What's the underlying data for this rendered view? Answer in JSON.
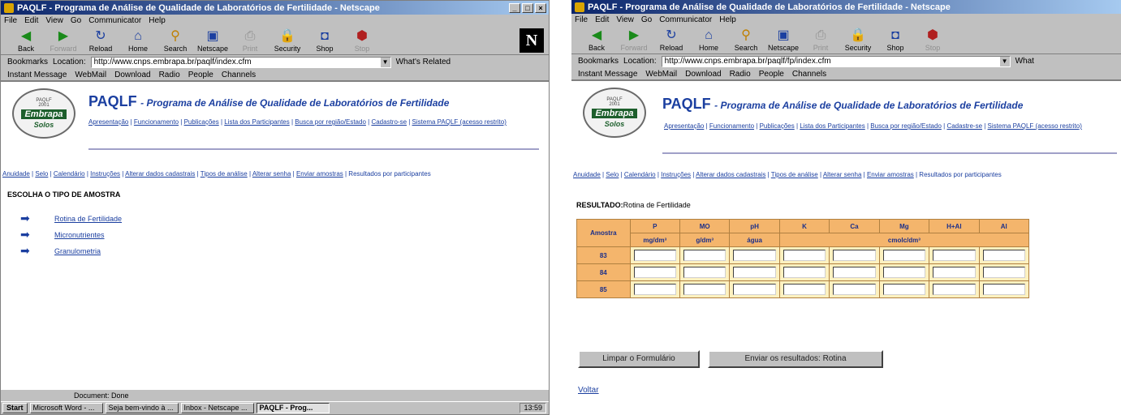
{
  "left": {
    "window_title": "PAQLF - Programa de Análise de Qualidade de Laboratórios de Fertilidade - Netscape",
    "menu": [
      "File",
      "Edit",
      "View",
      "Go",
      "Communicator",
      "Help"
    ],
    "toolbar": [
      "Back",
      "Forward",
      "Reload",
      "Home",
      "Search",
      "Netscape",
      "Print",
      "Security",
      "Shop",
      "Stop"
    ],
    "bookmarks_label": "Bookmarks",
    "location_label": "Location:",
    "url": "http://www.cnps.embrapa.br/paqlf/index.cfm",
    "related_label": "What's Related",
    "personal": [
      "Instant Message",
      "WebMail",
      "Download",
      "Radio",
      "People",
      "Channels"
    ],
    "logo": {
      "line1": "PAQLF",
      "line2": "2001",
      "brand": "Embrapa",
      "sub": "Solos"
    },
    "site_title": "PAQLF",
    "site_subtitle": "- Programa de Análise de Qualidade de Laboratórios de Fertilidade",
    "top_nav": [
      "Apresentação",
      "Funcionamento",
      "Publicações",
      "Lista dos Participantes",
      "Busca por região/Estado",
      "Cadastro-se",
      "Sistema PAQLF (acesso restrito)"
    ],
    "sub_nav": [
      "Anuidade",
      "Selo",
      "Calendário",
      "Instruções",
      "Alterar dados cadastrais",
      "Tipos de análise",
      "Alterar senha",
      "Enviar amostras",
      "Resultados por participantes"
    ],
    "heading": "ESCOLHA O TIPO DE AMOSTRA",
    "options": [
      "Rotina de Fertilidade",
      "Micronutrientes",
      "Granulometria"
    ],
    "status": "Document: Done",
    "taskbar": {
      "start": "Start",
      "tasks": [
        "Microsoft Word - ...",
        "Seja bem-vindo à ...",
        "Inbox - Netscape ...",
        "PAQLF - Prog..."
      ],
      "clock": "13:59"
    }
  },
  "right": {
    "window_title": "PAQLF - Programa de Análise de Qualidade de Laboratórios de Fertilidade - Netscape",
    "menu": [
      "File",
      "Edit",
      "View",
      "Go",
      "Communicator",
      "Help"
    ],
    "toolbar": [
      "Back",
      "Forward",
      "Reload",
      "Home",
      "Search",
      "Netscape",
      "Print",
      "Security",
      "Shop",
      "Stop"
    ],
    "bookmarks_label": "Bookmarks",
    "location_label": "Location:",
    "url": "http://www.cnps.embrapa.br/paqlf/fp/index.cfm",
    "related_label": "What",
    "personal": [
      "Instant Message",
      "WebMail",
      "Download",
      "Radio",
      "People",
      "Channels"
    ],
    "logo": {
      "line1": "PAQLF",
      "line2": "2001",
      "brand": "Embrapa",
      "sub": "Solos"
    },
    "site_title": "PAQLF",
    "site_subtitle": "- Programa de Análise de Qualidade de Laboratórios de Fertilidade",
    "top_nav": [
      "Apresentação",
      "Funcionamento",
      "Publicações",
      "Lista dos Participantes",
      "Busca por região/Estado",
      "Cadastre-se",
      "Sistema PAQLF (acesso restrito)"
    ],
    "sub_nav": [
      "Anuidade",
      "Selo",
      "Calendário",
      "Instruções",
      "Alterar dados cadastrais",
      "Tipos de análise",
      "Alterar senha",
      "Enviar amostras",
      "Resultados por participantes"
    ],
    "result_label": "RESULTADO:",
    "result_value": "Rotina de Fertilidade",
    "table": {
      "headers": [
        "Amostra",
        "P",
        "MO",
        "pH",
        "K",
        "Ca",
        "Mg",
        "H+Al",
        "Al"
      ],
      "units": [
        "mg/dm³",
        "g/dm³",
        "água",
        "cmolc/dm³"
      ],
      "rows": [
        "83",
        "84",
        "85"
      ]
    },
    "btn_clear": "Limpar o Formulário",
    "btn_send": "Enviar os resultados: Rotina",
    "back_link": "Voltar"
  }
}
